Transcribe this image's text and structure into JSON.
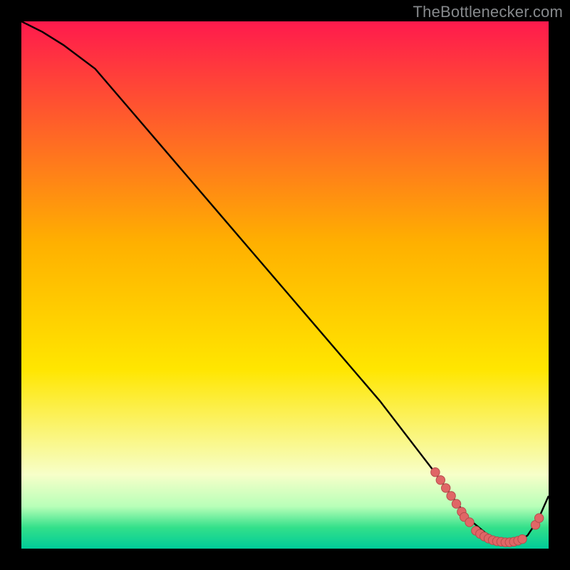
{
  "attribution": "TheBottlenecker.com",
  "colors": {
    "bg": "#000000",
    "curve": "#000000",
    "marker_fill": "#e06666",
    "marker_stroke": "#b54d4d",
    "grad_top": "#ff1a4d",
    "grad_mid_upper": "#ffb000",
    "grad_mid_lower": "#ffe600",
    "grad_pale": "#f7ffc9",
    "grad_green1": "#b8ffb8",
    "grad_green2": "#33e08a",
    "grad_green3": "#00cc99"
  },
  "chart_data": {
    "type": "line",
    "title": "",
    "xlabel": "",
    "ylabel": "",
    "xlim": [
      0,
      100
    ],
    "ylim": [
      0,
      100
    ],
    "grid": false,
    "legend": false,
    "series": [
      {
        "name": "bottleneck-curve",
        "x": [
          0,
          4,
          8,
          14,
          20,
          26,
          32,
          38,
          44,
          50,
          56,
          62,
          68,
          73,
          78,
          82,
          85,
          88,
          90,
          92,
          94,
          96,
          98,
          100
        ],
        "y": [
          100,
          98,
          95.5,
          91,
          84,
          77,
          70,
          63,
          56,
          49,
          42,
          35,
          28,
          21.5,
          15,
          9.5,
          5.5,
          3,
          1.8,
          1.2,
          1.2,
          2.5,
          5.5,
          10
        ]
      }
    ],
    "markers": {
      "name": "highlight-dots",
      "points": [
        {
          "x": 78.5,
          "y": 14.5
        },
        {
          "x": 79.5,
          "y": 13.0
        },
        {
          "x": 80.5,
          "y": 11.5
        },
        {
          "x": 81.5,
          "y": 10.0
        },
        {
          "x": 82.5,
          "y": 8.5
        },
        {
          "x": 83.5,
          "y": 7.0
        },
        {
          "x": 84.0,
          "y": 6.0
        },
        {
          "x": 85.0,
          "y": 5.0
        },
        {
          "x": 86.2,
          "y": 3.4
        },
        {
          "x": 87.0,
          "y": 2.8
        },
        {
          "x": 87.8,
          "y": 2.3
        },
        {
          "x": 88.6,
          "y": 1.9
        },
        {
          "x": 89.4,
          "y": 1.6
        },
        {
          "x": 90.2,
          "y": 1.4
        },
        {
          "x": 91.0,
          "y": 1.3
        },
        {
          "x": 91.8,
          "y": 1.2
        },
        {
          "x": 92.6,
          "y": 1.2
        },
        {
          "x": 93.4,
          "y": 1.3
        },
        {
          "x": 94.2,
          "y": 1.5
        },
        {
          "x": 95.0,
          "y": 1.8
        },
        {
          "x": 97.5,
          "y": 4.5
        },
        {
          "x": 98.2,
          "y": 5.8
        }
      ]
    }
  }
}
